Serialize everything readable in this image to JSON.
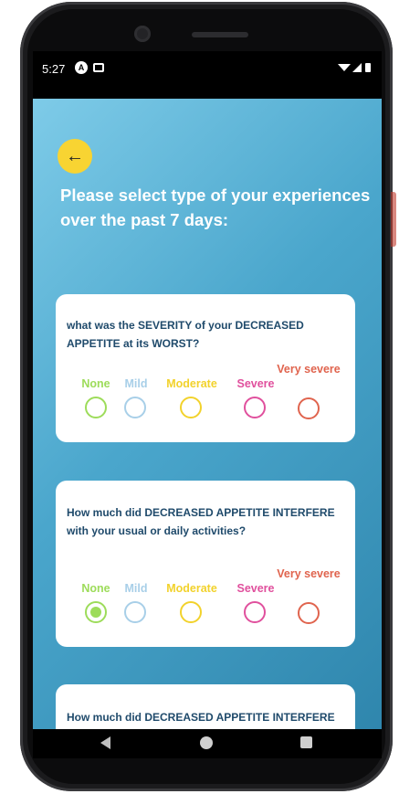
{
  "status": {
    "time": "5:27",
    "icons": [
      "notification-a-icon",
      "notification-card-icon",
      "wifi-icon",
      "signal-icon",
      "battery-icon"
    ]
  },
  "header": {
    "back_icon": "arrow-left-icon",
    "title": "Please select type of your experiences over the past 7 days:"
  },
  "colors": {
    "none": "#9ddc5a",
    "mild": "#a8cfe8",
    "moderate": "#f2d22c",
    "severe": "#e0509d",
    "very_severe": "#e0644e"
  },
  "questions": [
    {
      "text": "what was the SEVERITY of your DECREASED APPETITE at its WORST?",
      "options": [
        "None",
        "Mild",
        "Moderate",
        "Severe",
        "Very severe"
      ],
      "selected": null
    },
    {
      "text": "How much did DECREASED APPETITE INTERFERE with your usual or daily activities?",
      "options": [
        "None",
        "Mild",
        "Moderate",
        "Severe",
        "Very severe"
      ],
      "selected": "None"
    },
    {
      "text": "How much did DECREASED APPETITE INTERFERE with your usual or daily activities?"
    }
  ],
  "navbar": {
    "icons": [
      "nav-back-icon",
      "nav-home-icon",
      "nav-recents-icon"
    ]
  }
}
